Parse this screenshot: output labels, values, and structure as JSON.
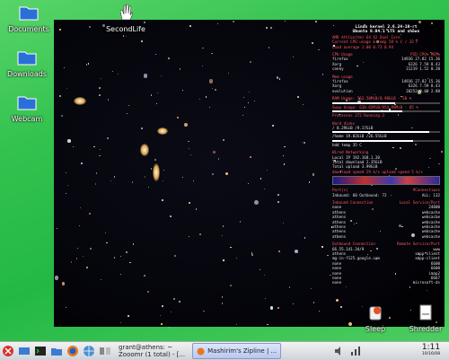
{
  "desktop_icons": [
    {
      "label": "Documents"
    },
    {
      "label": "SecondLife"
    },
    {
      "label": "Downloads"
    },
    {
      "label": "Webcam"
    },
    {
      "label": "Sleep"
    },
    {
      "label": "Shredder"
    }
  ],
  "conky": {
    "header1": "Linux kernel 2.6.24-19-rt",
    "header2": "Ubuntu 8.04.1 LTS and shows",
    "cpu_model": "AMD Athlon(tm) 64 X2 Dual Core",
    "cpu_usage": "Current CPU usage & temp  58 %  C / 32 F",
    "load_average": "Load average  1.00 0.73 0.94",
    "cpu_section": "CPU Usage",
    "cpu_cols": [
      "PID",
      "CPU%",
      "MEM%"
    ],
    "cpu_procs": [
      {
        "name": "firefox",
        "pid": "14936",
        "cpu": "27.82",
        "mem": "15.36"
      },
      {
        "name": "Xorg",
        "pid": "6326",
        "cpu": "7.59",
        "mem": "8.43"
      },
      {
        "name": "conky",
        "pid": "21219",
        "cpu": "1.52",
        "mem": "0.20"
      }
    ],
    "mem_section": "Mem usage",
    "mem_procs": [
      {
        "name": "firefox",
        "pid": "14936",
        "cpu": "27.82",
        "mem": "15.36"
      },
      {
        "name": "Xorg",
        "pid": "6326",
        "cpu": "7.59",
        "mem": "8.43"
      },
      {
        "name": "evolution",
        "pid": "20252",
        "cpu": "0.00",
        "mem": "2.88"
      }
    ],
    "ram_usage": "RAM Usage: 563.50MiB/0.98GiB - 58 %",
    "ram_percent": 0.58,
    "swap_usage": "Swap Usage: 630.65MiB/954.99MiB - 65 %",
    "swap_percent": 0.65,
    "processes": "Processes  272   Running  3",
    "hdd_section": "Hard disks",
    "disks": [
      {
        "label": "/  8.29GiB /9.17GiB",
        "percent": 0.9
      },
      {
        "label": "/home  19.82GiB /26.55GiB",
        "percent": 0.75
      },
      {
        "label": "hdd temp  35 C",
        "percent": 0
      }
    ],
    "net_section": "Wired Networking",
    "net_lines": [
      "Local IP  192.168.1.20",
      "Total download  2.35GiB",
      "Total upload  3.99GiB",
      "download speed  29   k/s        upload speed  5   k/s"
    ],
    "ports_title": "Port(s)",
    "ports_right": "#Connections",
    "ports_summary_left": "Inbound: 60  Outbound: 72",
    "ports_summary_right": "ALL: 132",
    "inbound_title": "Inbound Connection",
    "inbound_right": "Local Service/Port",
    "inbound_rows": [
      {
        "host": "none",
        "port": "24800"
      },
      {
        "host": "athens",
        "port": "webcache"
      },
      {
        "host": "athens",
        "port": "webcache"
      },
      {
        "host": "athens",
        "port": "webcache"
      },
      {
        "host": "athens",
        "port": "webcache"
      },
      {
        "host": "athens",
        "port": "webcache"
      },
      {
        "host": "athens",
        "port": "webcache"
      }
    ],
    "outbound_title": "Outbound Connection",
    "outbound_right": "Remote Service/Port",
    "outbound_rows": [
      {
        "host": "66.55.141.34/9",
        "port": "www"
      },
      {
        "host": "athens",
        "port": "xmpp-client"
      },
      {
        "host": "mg-in-f125.google.com",
        "port": "xmpp-client"
      },
      {
        "host": "none",
        "port": "6600"
      },
      {
        "host": "none",
        "port": "6600"
      },
      {
        "host": "none",
        "port": "imap2"
      },
      {
        "host": "none",
        "port": "6667"
      },
      {
        "host": "none",
        "port": "microsoft-ds"
      }
    ]
  },
  "taskbar": {
    "tasks": [
      {
        "label": "grant@athens: ~"
      },
      {
        "label": "Zooomr (1 total) - [..."
      },
      {
        "label": "Mashirim's Zipline | ..."
      }
    ],
    "clock_time": "1:11",
    "clock_date": "10/16/08"
  }
}
